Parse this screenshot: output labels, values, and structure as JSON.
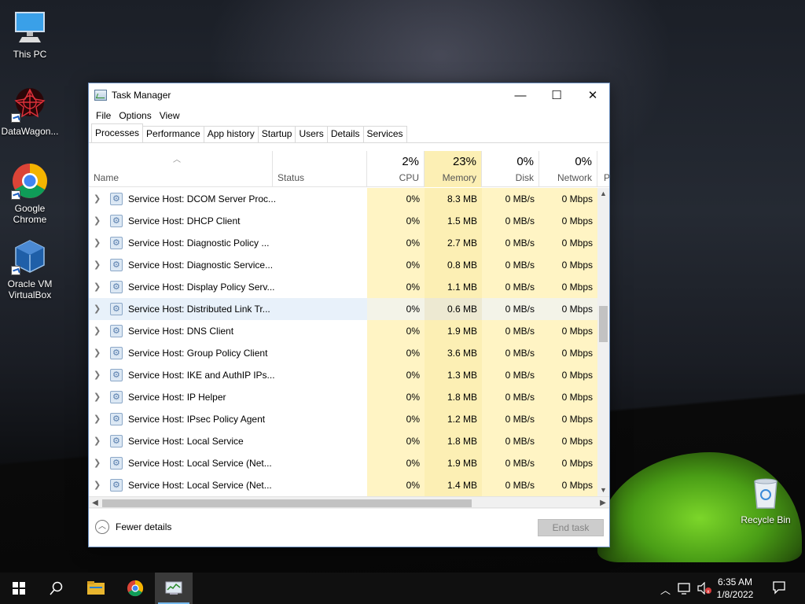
{
  "desktop": {
    "icons": [
      {
        "label": "This PC",
        "icon": "monitor-icon"
      },
      {
        "label": "DataWagon...",
        "icon": "datawagon-icon"
      },
      {
        "label": "Google Chrome",
        "icon": "chrome-icon"
      },
      {
        "label": "Oracle VM VirtualBox",
        "icon": "virtualbox-icon"
      },
      {
        "label": "Recycle Bin",
        "icon": "recycle-bin-icon"
      }
    ]
  },
  "window": {
    "title": "Task Manager",
    "controls": {
      "minimize": "—",
      "maximize": "☐",
      "close": "✕"
    },
    "menu": [
      "File",
      "Options",
      "View"
    ],
    "tabs": [
      "Processes",
      "Performance",
      "App history",
      "Startup",
      "Users",
      "Details",
      "Services"
    ],
    "active_tab": "Processes",
    "columns": {
      "name": "Name",
      "status": "Status",
      "cpu": {
        "pct": "2%",
        "label": "CPU"
      },
      "memory": {
        "pct": "23%",
        "label": "Memory"
      },
      "disk": {
        "pct": "0%",
        "label": "Disk"
      },
      "network": {
        "pct": "0%",
        "label": "Network"
      },
      "power": "P"
    },
    "rows": [
      {
        "name": "Service Host: DCOM Server Proc...",
        "cpu": "0%",
        "memory": "8.3 MB",
        "disk": "0 MB/s",
        "network": "0 Mbps"
      },
      {
        "name": "Service Host: DHCP Client",
        "cpu": "0%",
        "memory": "1.5 MB",
        "disk": "0 MB/s",
        "network": "0 Mbps"
      },
      {
        "name": "Service Host: Diagnostic Policy ...",
        "cpu": "0%",
        "memory": "2.7 MB",
        "disk": "0 MB/s",
        "network": "0 Mbps"
      },
      {
        "name": "Service Host: Diagnostic Service...",
        "cpu": "0%",
        "memory": "0.8 MB",
        "disk": "0 MB/s",
        "network": "0 Mbps"
      },
      {
        "name": "Service Host: Display Policy Serv...",
        "cpu": "0%",
        "memory": "1.1 MB",
        "disk": "0 MB/s",
        "network": "0 Mbps"
      },
      {
        "name": "Service Host: Distributed Link Tr...",
        "cpu": "0%",
        "memory": "0.6 MB",
        "disk": "0 MB/s",
        "network": "0 Mbps"
      },
      {
        "name": "Service Host: DNS Client",
        "cpu": "0%",
        "memory": "1.9 MB",
        "disk": "0 MB/s",
        "network": "0 Mbps"
      },
      {
        "name": "Service Host: Group Policy Client",
        "cpu": "0%",
        "memory": "3.6 MB",
        "disk": "0 MB/s",
        "network": "0 Mbps"
      },
      {
        "name": "Service Host: IKE and AuthIP IPs...",
        "cpu": "0%",
        "memory": "1.3 MB",
        "disk": "0 MB/s",
        "network": "0 Mbps"
      },
      {
        "name": "Service Host: IP Helper",
        "cpu": "0%",
        "memory": "1.8 MB",
        "disk": "0 MB/s",
        "network": "0 Mbps"
      },
      {
        "name": "Service Host: IPsec Policy Agent",
        "cpu": "0%",
        "memory": "1.2 MB",
        "disk": "0 MB/s",
        "network": "0 Mbps"
      },
      {
        "name": "Service Host: Local Service",
        "cpu": "0%",
        "memory": "1.8 MB",
        "disk": "0 MB/s",
        "network": "0 Mbps"
      },
      {
        "name": "Service Host: Local Service (Net...",
        "cpu": "0%",
        "memory": "1.9 MB",
        "disk": "0 MB/s",
        "network": "0 Mbps"
      },
      {
        "name": "Service Host: Local Service (Net...",
        "cpu": "0%",
        "memory": "1.4 MB",
        "disk": "0 MB/s",
        "network": "0 Mbps"
      }
    ],
    "selected_row": 5,
    "footer": {
      "fewer_details": "Fewer details",
      "end_task": "End task"
    }
  },
  "taskbar": {
    "items": [
      "windows-start-icon",
      "search-icon",
      "file-explorer-icon",
      "chrome-icon",
      "task-manager-icon"
    ],
    "clock": {
      "time": "6:35 AM",
      "date": "1/8/2022"
    }
  }
}
